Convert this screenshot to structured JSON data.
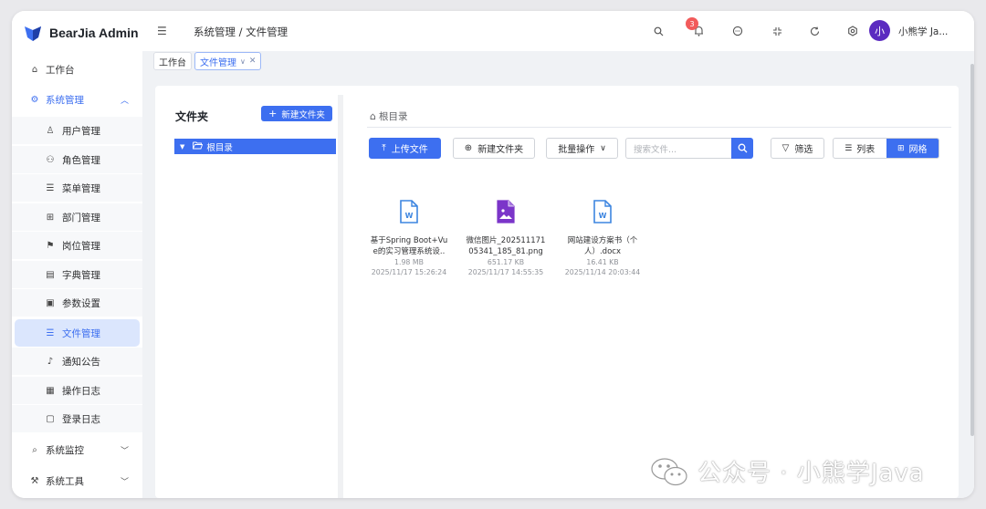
{
  "app": {
    "title": "BearJia Admin"
  },
  "sidebar": {
    "items": [
      {
        "label": "工作台",
        "icon": "home-icon"
      },
      {
        "label": "系统管理",
        "icon": "gear-icon",
        "expanded": true
      },
      {
        "label": "用户管理",
        "icon": "user-icon"
      },
      {
        "label": "角色管理",
        "icon": "role-icon"
      },
      {
        "label": "菜单管理",
        "icon": "menu-list-icon"
      },
      {
        "label": "部门管理",
        "icon": "org-tree-icon"
      },
      {
        "label": "岗位管理",
        "icon": "flag-icon"
      },
      {
        "label": "字典管理",
        "icon": "book-icon"
      },
      {
        "label": "参数设置",
        "icon": "settings-doc-icon"
      },
      {
        "label": "文件管理",
        "icon": "file-list-icon",
        "active": true
      },
      {
        "label": "通知公告",
        "icon": "bell-icon"
      },
      {
        "label": "操作日志",
        "icon": "clipboard-icon"
      },
      {
        "label": "登录日志",
        "icon": "login-log-icon"
      },
      {
        "label": "系统监控",
        "icon": "monitor-icon"
      },
      {
        "label": "系统工具",
        "icon": "tool-icon"
      }
    ]
  },
  "header": {
    "breadcrumb": "系统管理 / 文件管理",
    "notification_count": "3",
    "avatar_text": "小",
    "username": "小熊学 Ja..."
  },
  "tabs": [
    {
      "label": "工作台"
    },
    {
      "label": "文件管理",
      "active": true
    }
  ],
  "folder_panel": {
    "title": "文件夹",
    "new_folder_button": "新建文件夹",
    "root_label": "根目录"
  },
  "file_panel": {
    "breadcrumb": "根目录",
    "upload_button": "上传文件",
    "new_folder_button": "新建文件夹",
    "batch_button": "批量操作",
    "search_placeholder": "搜索文件...",
    "filter_button": "筛选",
    "view_list": "列表",
    "view_grid": "网格",
    "files": [
      {
        "name": "基于Spring Boot+Vue的实习管理系统设..",
        "size": "1.98 MB",
        "date": "2025/11/17 15:26:24",
        "type": "word",
        "color": "#3d85e0"
      },
      {
        "name": "微信图片_20251117105341_185_81.png",
        "size": "651.17 KB",
        "date": "2025/11/17 14:55:35",
        "type": "image",
        "color": "#7b35c9"
      },
      {
        "name": "网站建设方案书（个人）.docx",
        "size": "16.41 KB",
        "date": "2025/11/14 20:03:44",
        "type": "word",
        "color": "#3d85e0"
      }
    ]
  },
  "watermark": {
    "text": "公众号 · 小熊学Java"
  },
  "colors": {
    "primary": "#3d6ff0",
    "badge": "#f25b5b",
    "avatar": "#5b2bc0"
  }
}
